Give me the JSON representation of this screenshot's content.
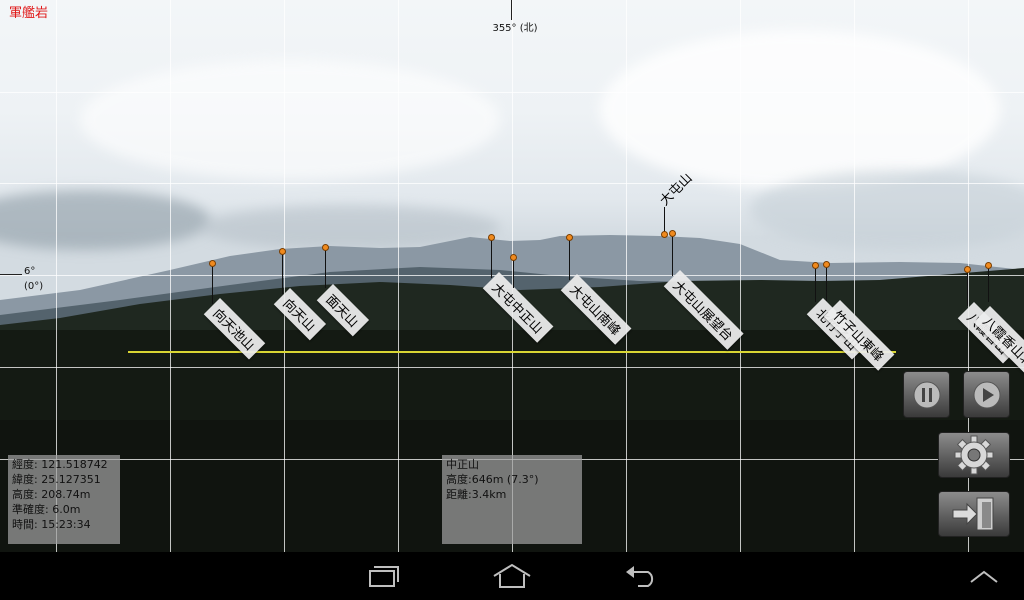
{
  "location_title": "軍艦岩",
  "compass": {
    "heading_label": "355° (北)"
  },
  "elevation_scale": {
    "degrees": "6°",
    "offset": "(0°)"
  },
  "peaks": [
    {
      "name": "向天池山"
    },
    {
      "name": "向天山"
    },
    {
      "name": "面天山"
    },
    {
      "name": "大屯中正山"
    },
    {
      "name": "大屯山南峰"
    },
    {
      "name": "大屯山"
    },
    {
      "name": "大屯山展望台"
    },
    {
      "name": "北竹子山"
    },
    {
      "name": "竹子山東峰"
    },
    {
      "name": "八霞香山"
    },
    {
      "name": "八霞香山北峰"
    }
  ],
  "gps_info": {
    "longitude": "經度: 121.518742",
    "latitude": "緯度: 25.127351",
    "altitude": "高度: 208.74m",
    "accuracy": "準確度: 6.0m",
    "time": "時間: 15:23:34"
  },
  "target_info": {
    "name": "中正山",
    "height": "高度:646m (7.3°)",
    "distance": "距離:3.4km"
  },
  "controls": {
    "pause": "pause-icon",
    "play": "play-icon",
    "settings": "gear-icon",
    "exit": "exit-icon"
  },
  "navbar": {
    "recent": "recent-apps-icon",
    "home": "home-icon",
    "back": "back-icon",
    "up": "chevron-up-icon"
  },
  "colors": {
    "title": "#e01818",
    "pin_dot": "#f08a1e",
    "horizon_line": "#d9d633"
  }
}
